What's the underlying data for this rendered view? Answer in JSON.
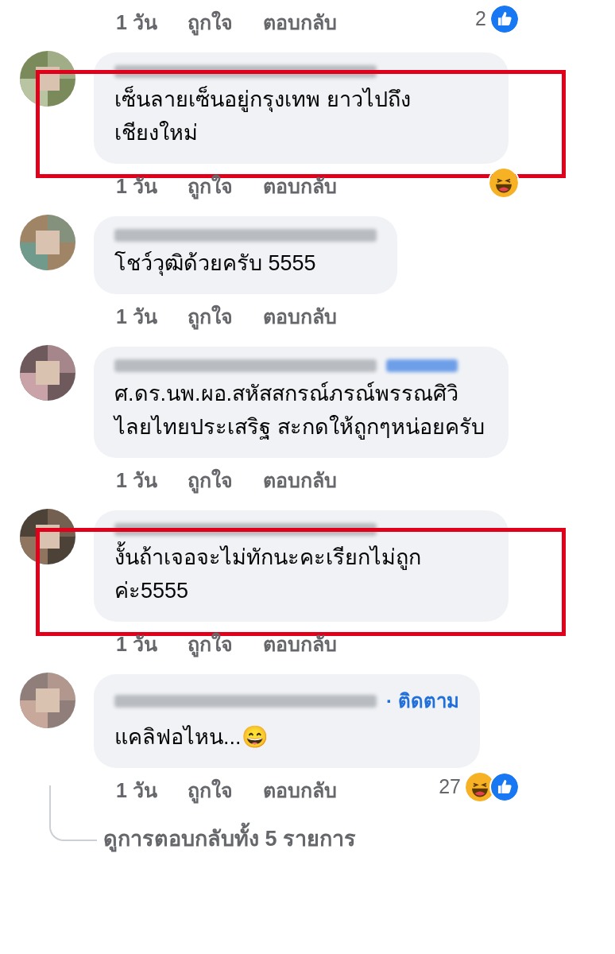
{
  "top_meta": {
    "time": "1 วัน",
    "like": "ถูกใจ",
    "reply": "ตอบกลับ",
    "reaction_count": "2",
    "reactions": [
      {
        "kind": "like"
      }
    ]
  },
  "comments": [
    {
      "highlighted": true,
      "name_badge": false,
      "text": "เซ็นลายเซ็นอยู่กรุงเทพ ยาวไปถึงเชียงใหม่",
      "meta": {
        "time": "1 วัน",
        "like": "ถูกใจ",
        "reply": "ตอบกลับ",
        "reactions": [
          {
            "kind": "haha"
          }
        ]
      }
    },
    {
      "highlighted": false,
      "name_badge": false,
      "text": "โชว์วุฒิด้วยครับ 5555",
      "meta": {
        "time": "1 วัน",
        "like": "ถูกใจ",
        "reply": "ตอบกลับ"
      }
    },
    {
      "highlighted": false,
      "name_badge": true,
      "text": "ศ.ดร.นพ.ผอ.สหัสสกรณ์ภรณ์พรรณศิวิไลยไทยประเสริฐ สะกดให้ถูกๆหน่อยครับ",
      "meta": {
        "time": "1 วัน",
        "like": "ถูกใจ",
        "reply": "ตอบกลับ"
      }
    },
    {
      "highlighted": true,
      "name_badge": false,
      "text": "งั้นถ้าเจอจะไม่ทักนะคะเรียกไม่ถูกค่ะ5555",
      "meta": {
        "time": "1 วัน",
        "like": "ถูกใจ",
        "reply": "ตอบกลับ"
      }
    },
    {
      "highlighted": false,
      "name_badge": false,
      "follow": "· ติดตาม",
      "text": "แคลิฟอไหน...😄",
      "meta": {
        "time": "1 วัน",
        "like": "ถูกใจ",
        "reply": "ตอบกลับ",
        "reaction_count": "27",
        "reactions": [
          {
            "kind": "haha"
          },
          {
            "kind": "like"
          }
        ]
      }
    }
  ],
  "view_replies": "ดูการตอบกลับทั้ง 5 รายการ"
}
